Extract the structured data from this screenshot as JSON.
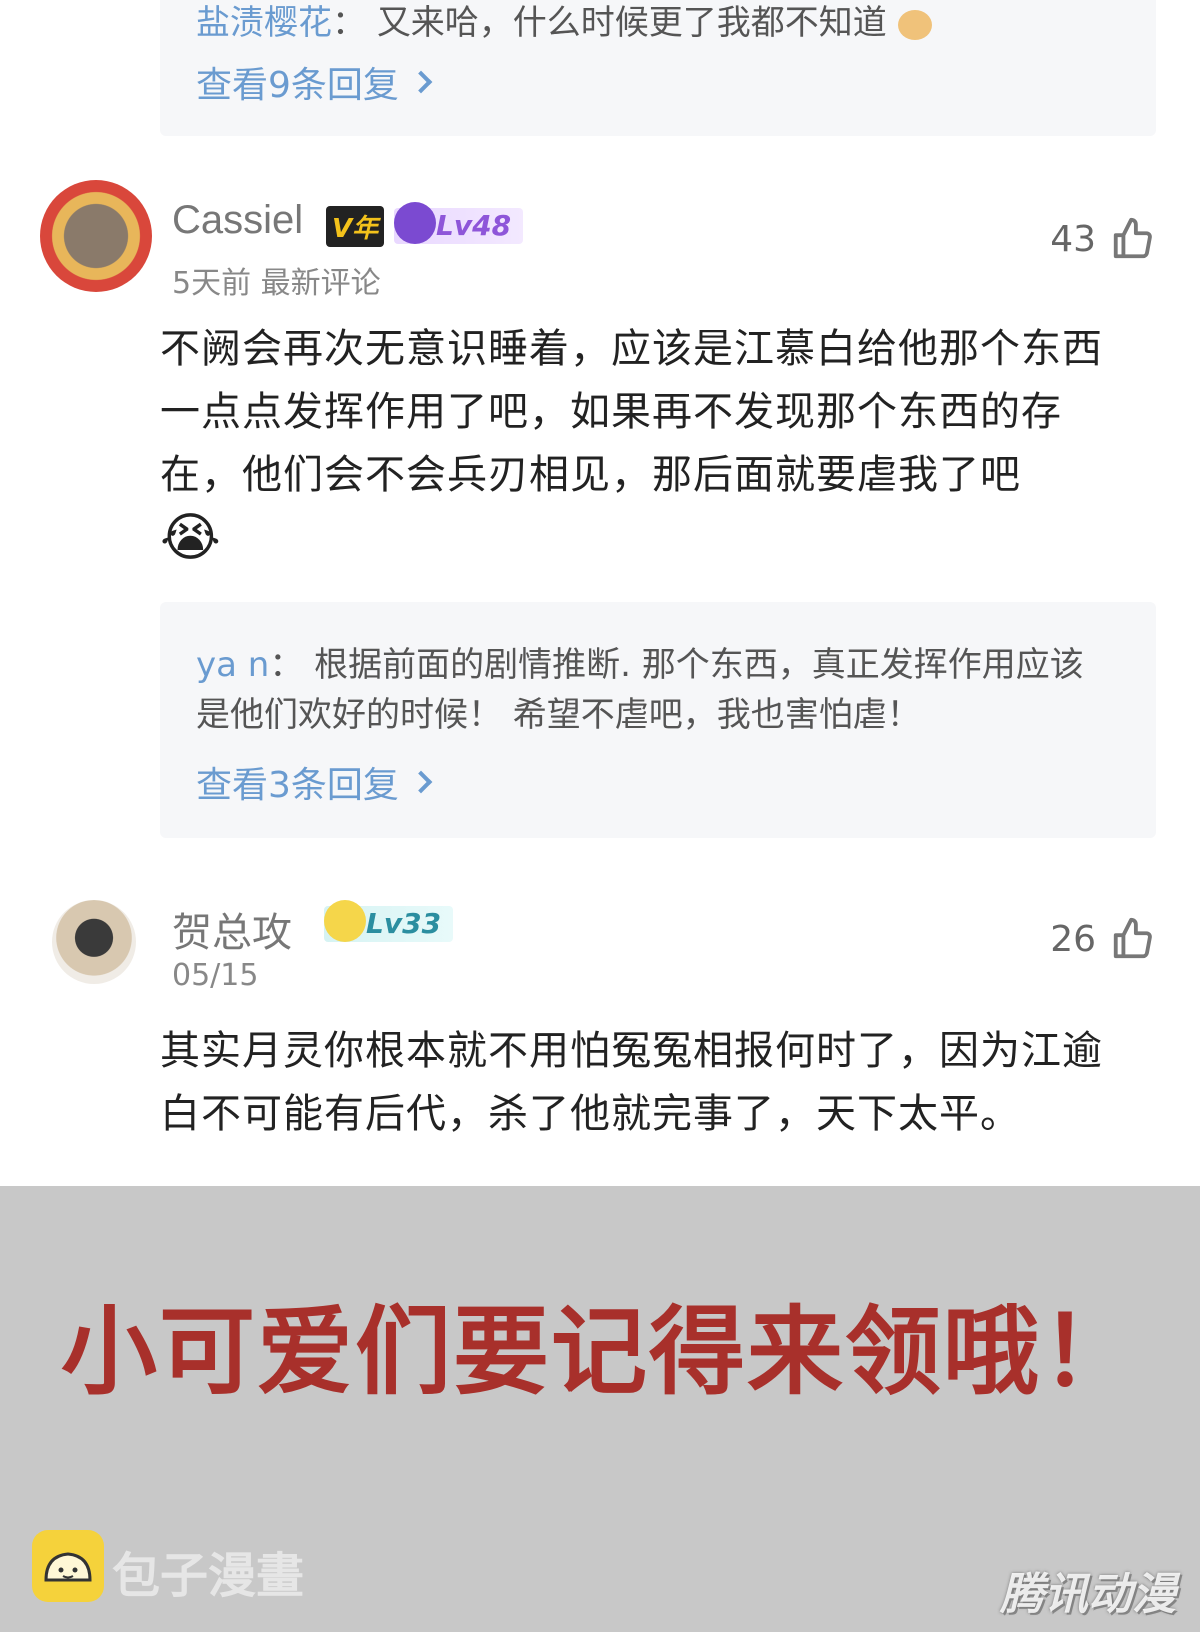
{
  "top_reply": {
    "user": "盐渍樱花",
    "separator": "：",
    "text": "又来哈，什么时候更了我都不知道",
    "more": "查看9条回复"
  },
  "comments": [
    {
      "user": "Cassiel",
      "badge_v": "V年",
      "level": "Lv48",
      "meta": "5天前 最新评论",
      "likes": "43",
      "body": "不阙会再次无意识睡着，应该是江慕白给他那个东西一点点发挥作用了吧，如果再不发现那个东西的存在，他们会不会兵刃相见，那后面就要虐我了吧",
      "emoji": "😭",
      "reply": {
        "user": "ya n",
        "separator": "：",
        "text": "根据前面的剧情推断. 那个东西，真正发挥作用应该是他们欢好的时候！ 希望不虐吧，我也害怕虐！",
        "more": "查看3条回复"
      }
    },
    {
      "user": "贺总攻",
      "level": "Lv33",
      "meta": "05/15",
      "likes": "26",
      "body": "其实月灵你根本就不用怕冤冤相报何时了，因为江逾白不可能有后代，杀了他就完事了，天下太平。"
    }
  ],
  "promo": {
    "title": "小可爱们要记得来领哦！",
    "logo_text": "包子漫畫",
    "watermark": "腾讯动漫"
  },
  "colors": {
    "link": "#6a9bd0",
    "promo_bg": "#c8c8c8",
    "promo_title": "#a8302b"
  },
  "icons": [
    "thumbs-up-icon",
    "chevron-right-icon",
    "crying-emoji-icon",
    "bun-logo-icon"
  ]
}
